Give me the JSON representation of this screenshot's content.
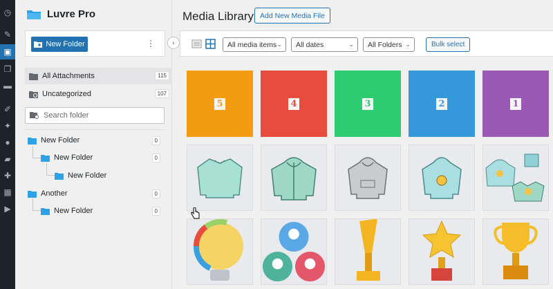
{
  "brand": {
    "name": "Luvre Pro"
  },
  "folder_panel": {
    "new_folder_label": "New Folder",
    "all_attachments": {
      "label": "All Attachments",
      "count": "115"
    },
    "uncategorized": {
      "label": "Uncategorized",
      "count": "107"
    },
    "search_placeholder": "Search folder",
    "tree": [
      {
        "label": "New Folder",
        "count": "0",
        "depth": 0
      },
      {
        "label": "New Folder",
        "count": "0",
        "depth": 1
      },
      {
        "label": "New Folder",
        "count": "",
        "depth": 2
      },
      {
        "label": "Another",
        "count": "0",
        "depth": 0
      },
      {
        "label": "New Folder",
        "count": "0",
        "depth": 1
      }
    ]
  },
  "main": {
    "title": "Media Library",
    "add_new_label": "Add New Media File",
    "filters": {
      "media_items": "All media items",
      "dates": "All dates",
      "folders": "All Folders",
      "bulk_select": "Bulk select"
    }
  },
  "tiles": [
    {
      "kind": "number",
      "number": "5",
      "color": "#f39c12"
    },
    {
      "kind": "number",
      "number": "4",
      "color": "#e74c3c"
    },
    {
      "kind": "number",
      "number": "3",
      "color": "#2ecc71"
    },
    {
      "kind": "number",
      "number": "2",
      "color": "#3498db"
    },
    {
      "kind": "number",
      "number": "1",
      "color": "#9b59b6"
    },
    {
      "kind": "image",
      "icon": "sweater-icon"
    },
    {
      "kind": "image",
      "icon": "zip-hoodie-icon"
    },
    {
      "kind": "image",
      "icon": "gray-hoodie-icon"
    },
    {
      "kind": "image",
      "icon": "smiley-hoodie-icon"
    },
    {
      "kind": "image",
      "icon": "merch-set-icon"
    },
    {
      "kind": "image",
      "icon": "lightbulb-icon"
    },
    {
      "kind": "image",
      "icon": "team-network-icon"
    },
    {
      "kind": "image",
      "icon": "trophy-cup-icon"
    },
    {
      "kind": "image",
      "icon": "star-trophy-icon"
    },
    {
      "kind": "image",
      "icon": "gold-cup-icon"
    }
  ],
  "colors": {
    "accent": "#2271b1",
    "rail": "#1d2327",
    "folder": "#2ea2e6"
  }
}
